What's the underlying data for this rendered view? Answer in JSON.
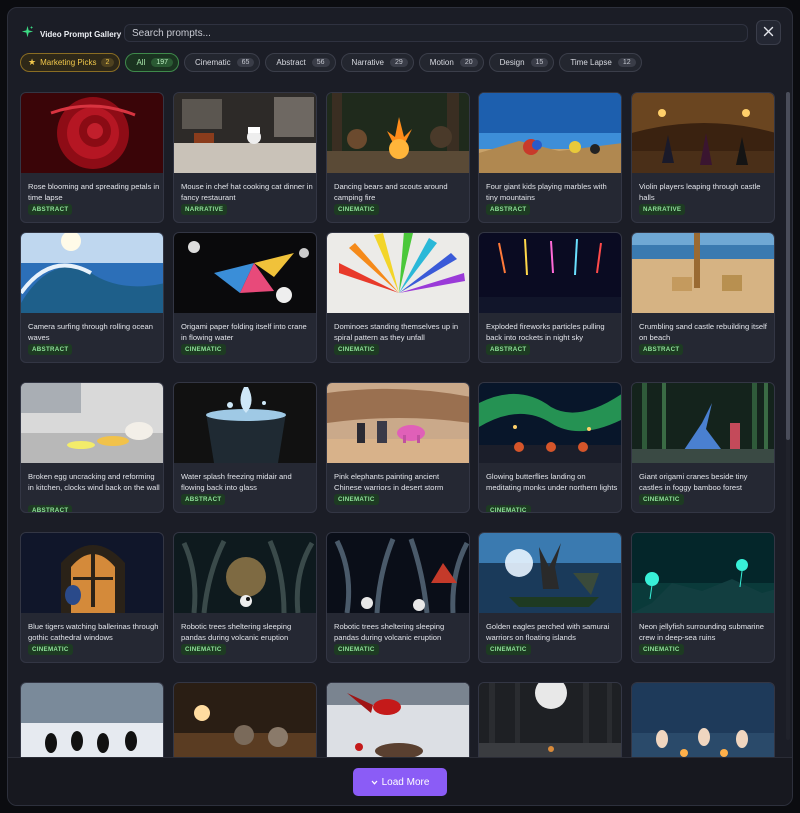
{
  "header": {
    "title": "Video Prompt Gallery",
    "search_placeholder": "Search prompts...",
    "close_icon": "close-icon",
    "brand_icon": "sparkle-icon",
    "brand_color": "#3ddc84"
  },
  "filters": [
    {
      "label": "Marketing Picks",
      "count": "2",
      "style": "marketing"
    },
    {
      "label": "All",
      "count": "197",
      "style": "active"
    },
    {
      "label": "Cinematic",
      "count": "65",
      "style": ""
    },
    {
      "label": "Abstract",
      "count": "56",
      "style": ""
    },
    {
      "label": "Narrative",
      "count": "29",
      "style": ""
    },
    {
      "label": "Motion",
      "count": "20",
      "style": ""
    },
    {
      "label": "Design",
      "count": "15",
      "style": ""
    },
    {
      "label": "Time Lapse",
      "count": "12",
      "style": ""
    }
  ],
  "cards": [
    {
      "caption": "Rose blooming and spreading petals in time lapse",
      "tag": "ABSTRACT",
      "scene": "rose"
    },
    {
      "caption": "Mouse in chef hat cooking cat dinner in fancy restaurant",
      "tag": "NARRATIVE",
      "scene": "kitchen"
    },
    {
      "caption": "Dancing bears and scouts around camping fire",
      "tag": "CINEMATIC",
      "scene": "campfire"
    },
    {
      "caption": "Four giant kids playing marbles with tiny mountains",
      "tag": "ABSTRACT",
      "scene": "desert"
    },
    {
      "caption": "Violin players leaping through castle halls",
      "tag": "NARRATIVE",
      "scene": "castle"
    },
    {
      "caption": "Camera surfing through rolling ocean waves",
      "tag": "ABSTRACT",
      "scene": "wave"
    },
    {
      "caption": "Origami paper folding itself into crane in flowing water",
      "tag": "CINEMATIC",
      "scene": "origami"
    },
    {
      "caption": "Dominoes standing themselves up in spiral pattern as they unfall",
      "tag": "CINEMATIC",
      "scene": "dominoes"
    },
    {
      "caption": "Exploded fireworks particles pulling back into rockets in night sky",
      "tag": "ABSTRACT",
      "scene": "fireworks"
    },
    {
      "caption": "Crumbling sand castle rebuilding itself on beach",
      "tag": "ABSTRACT",
      "scene": "sandcastle"
    },
    {
      "caption": "Broken egg uncracking and reforming in kitchen, clocks wind back on the wall",
      "tag": "ABSTRACT",
      "scene": "egg"
    },
    {
      "caption": "Water splash freezing midair and flowing back into glass",
      "tag": "ABSTRACT",
      "scene": "splash"
    },
    {
      "caption": "Pink elephants painting ancient Chinese warriors in desert storm",
      "tag": "CINEMATIC",
      "scene": "elephants"
    },
    {
      "caption": "Glowing butterflies landing on meditating monks under northern lights",
      "tag": "CINEMATIC",
      "scene": "aurora"
    },
    {
      "caption": "Giant origami cranes beside tiny castles in foggy bamboo forest",
      "tag": "CINEMATIC",
      "scene": "bamboo"
    },
    {
      "caption": "Blue tigers watching ballerinas through gothic cathedral windows",
      "tag": "CINEMATIC",
      "scene": "cathedral"
    },
    {
      "caption": "Robotic trees sheltering sleeping pandas during volcanic eruption",
      "tag": "CINEMATIC",
      "scene": "trees"
    },
    {
      "caption": "Robotic trees sheltering sleeping pandas during volcanic eruption",
      "tag": "CINEMATIC",
      "scene": "trees2"
    },
    {
      "caption": "Golden eagles perched with samurai warriors on floating islands",
      "tag": "CINEMATIC",
      "scene": "eagle"
    },
    {
      "caption": "Neon jellyfish surrounding submarine crew in deep-sea ruins",
      "tag": "CINEMATIC",
      "scene": "jellyfish"
    },
    {
      "caption": "",
      "tag": "",
      "scene": "penguins"
    },
    {
      "caption": "",
      "tag": "",
      "scene": "cats"
    },
    {
      "caption": "",
      "tag": "",
      "scene": "cardinal"
    },
    {
      "caption": "",
      "tag": "",
      "scene": "forest"
    },
    {
      "caption": "",
      "tag": "",
      "scene": "bunnies"
    }
  ],
  "footer": {
    "load_more_label": "Load More",
    "load_more_icon": "chevron-down-icon",
    "accent_color": "#8b5cf6"
  }
}
